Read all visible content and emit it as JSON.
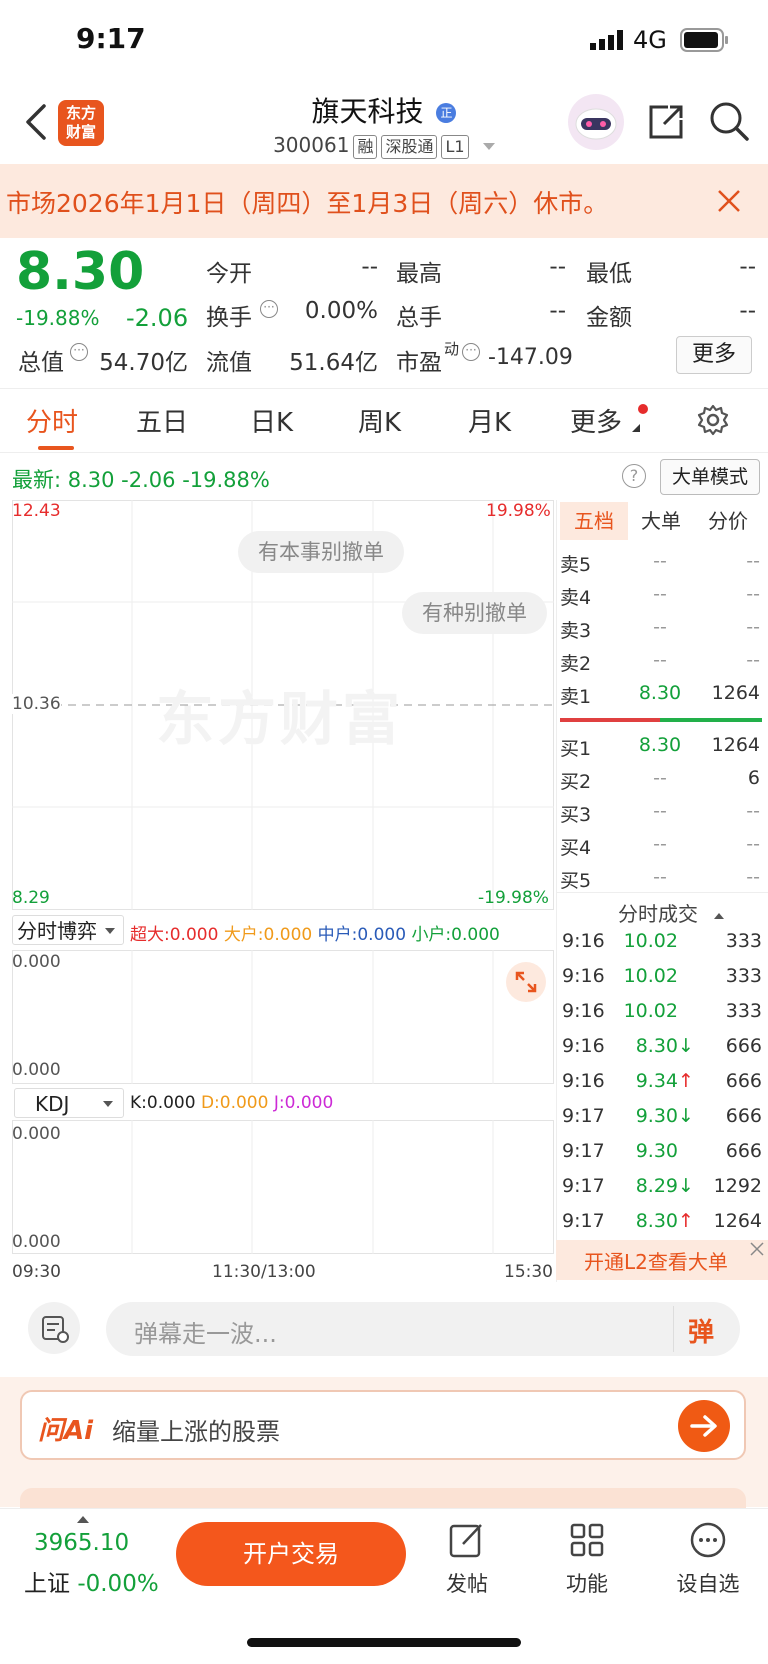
{
  "status_bar": {
    "time": "9:17",
    "network": "4G"
  },
  "header": {
    "logo_text_1": "东方",
    "logo_text_2": "财富",
    "stock_name": "旗天科技",
    "name_badge": "正",
    "stock_code": "300061",
    "tags": [
      "融",
      "深股通",
      "L1"
    ]
  },
  "banner": {
    "text": "市场2026年1月1日（周四）至1月3日（周六）休市。"
  },
  "quote": {
    "price": "8.30",
    "change_pct": "-19.88%",
    "change": "-2.06",
    "open_label": "今开",
    "open": "--",
    "high_label": "最高",
    "high": "--",
    "low_label": "最低",
    "low": "--",
    "turnover_label": "换手",
    "turnover": "0.00%",
    "volume_label": "总手",
    "volume": "--",
    "amount_label": "金额",
    "amount": "--",
    "mktcap_label": "总值",
    "mktcap": "54.70亿",
    "float_label": "流值",
    "float_cap": "51.64亿",
    "pe_label": "市盈",
    "pe_sup": "动",
    "pe": "-147.09",
    "more_label": "更多"
  },
  "tabs": [
    "分时",
    "五日",
    "日K",
    "周K",
    "月K",
    "更多"
  ],
  "latest": {
    "text": "最新:  8.30   -2.06   -19.88%",
    "bigorder_label": "大单模式"
  },
  "chart": {
    "y_max": "12.43",
    "y_mid": "10.36",
    "y_min": "8.29",
    "pct_max": "19.98%",
    "pct_min": "-19.98%",
    "danmu_1": "有本事别撤单",
    "danmu_2": "有种别撤单",
    "watermark": "东方财富",
    "sub1_select": "分时博弈",
    "sub1_legend": [
      {
        "label": "超大:0.000",
        "color": "#e62c2c"
      },
      {
        "label": "大户:0.000",
        "color": "#f09a1a"
      },
      {
        "label": "中户:0.000",
        "color": "#2a5bb8"
      },
      {
        "label": "小户:0.000",
        "color": "#13a03a"
      }
    ],
    "sub1_top": "0.000",
    "sub1_bottom": "0.000",
    "sub2_select": "KDJ",
    "sub2_legend": [
      {
        "label": "K:0.000",
        "color": "#222222"
      },
      {
        "label": "D:0.000",
        "color": "#f09a1a"
      },
      {
        "label": "J:0.000",
        "color": "#cc2ad6"
      }
    ],
    "sub2_top": "0.000",
    "sub2_bottom": "0.000",
    "x_labels": [
      "09:30",
      "11:30/13:00",
      "15:30"
    ]
  },
  "orderbook": {
    "tabs": [
      "五档",
      "大单",
      "分价"
    ],
    "sells": [
      {
        "label": "卖5",
        "price": "--",
        "vol": "--"
      },
      {
        "label": "卖4",
        "price": "--",
        "vol": "--"
      },
      {
        "label": "卖3",
        "price": "--",
        "vol": "--"
      },
      {
        "label": "卖2",
        "price": "--",
        "vol": "--"
      },
      {
        "label": "卖1",
        "price": "8.30",
        "vol": "1264"
      }
    ],
    "buys": [
      {
        "label": "买1",
        "price": "8.30",
        "vol": "1264"
      },
      {
        "label": "买2",
        "price": "--",
        "vol": "6"
      },
      {
        "label": "买3",
        "price": "--",
        "vol": "--"
      },
      {
        "label": "买4",
        "price": "--",
        "vol": "--"
      },
      {
        "label": "买5",
        "price": "--",
        "vol": "--"
      }
    ],
    "ticks_title": "分时成交",
    "ticks": [
      {
        "time": "9:16",
        "price": "10.02",
        "vol": "333",
        "arrow": ""
      },
      {
        "time": "9:16",
        "price": "10.02",
        "vol": "333",
        "arrow": ""
      },
      {
        "time": "9:16",
        "price": "10.02",
        "vol": "333",
        "arrow": ""
      },
      {
        "time": "9:16",
        "price": "8.30",
        "vol": "666",
        "arrow": "↓"
      },
      {
        "time": "9:16",
        "price": "9.34",
        "vol": "666",
        "arrow": "↑"
      },
      {
        "time": "9:17",
        "price": "9.30",
        "vol": "666",
        "arrow": "↓"
      },
      {
        "time": "9:17",
        "price": "9.30",
        "vol": "666",
        "arrow": ""
      },
      {
        "time": "9:17",
        "price": "8.29",
        "vol": "1292",
        "arrow": "↓"
      },
      {
        "time": "9:17",
        "price": "8.30",
        "vol": "1264",
        "arrow": "↑"
      }
    ],
    "l2_promo": "开通L2查看大单"
  },
  "danmaku": {
    "placeholder": "弹幕走一波...",
    "send_label": "弹"
  },
  "ai": {
    "logo": "问Ai",
    "query": "缩量上涨的股票"
  },
  "bottom_nav": {
    "index_value": "3965.10",
    "index_name": "上证",
    "index_change": "-0.00%",
    "trade_label": "开户交易",
    "post_label": "发帖",
    "func_label": "功能",
    "watch_label": "设自选"
  }
}
